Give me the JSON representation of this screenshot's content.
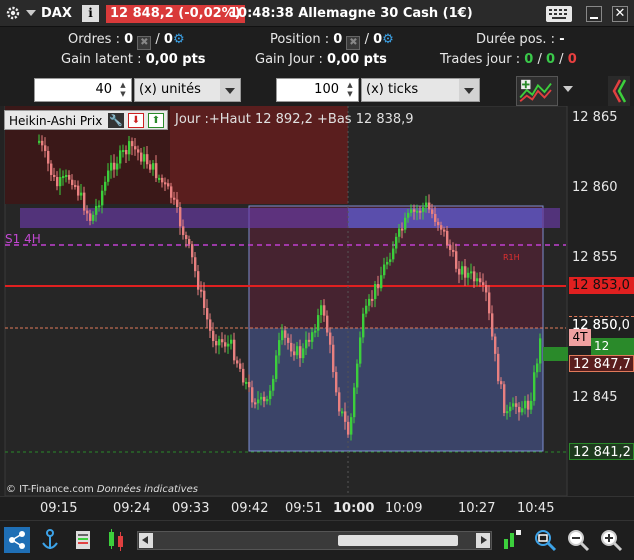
{
  "titlebar": {
    "instrument": "DAX",
    "info_icon": "i",
    "price_change": "12 848,2 (-0,02%)",
    "title": "10:48:38 Allemagne 30 Cash (1€)",
    "icons": [
      "gear-icon",
      "chevron-down-icon",
      "info-icon",
      "keyboard-icon",
      "minimize-icon",
      "close-icon"
    ],
    "close_glyph": "✕"
  },
  "info": {
    "orders_label": "Ordres : ",
    "orders_value_a": "0",
    "orders_sep": " / ",
    "orders_value_b": "0",
    "position_label": "Position : ",
    "position_value_a": "0",
    "position_sep": " / ",
    "position_value_b": "0",
    "duration_label": "Durée pos. : ",
    "duration_value": "-",
    "latent_label": "Gain latent : ",
    "latent_value": "0,00 pts",
    "gain_day_label": "Gain Jour : ",
    "gain_day_value": "0,00 pts",
    "trades_label": "Trades jour : ",
    "trades_a": "0",
    "trades_sep1": " / ",
    "trades_b": "0",
    "trades_sep2": " / ",
    "trades_c": "0"
  },
  "toolbar": {
    "units_value": "40",
    "units_select": "(x) unités",
    "ticks_value": "100",
    "ticks_select": "(x) ticks"
  },
  "chart": {
    "indicator_label": "Heikin-Ashi Prix",
    "jour_label": "Jour :+Haut 12 892,2 +Bas 12 838,9",
    "s1_label": "S1 4H",
    "r1h_label": "R1H",
    "watermark_brand": "© IT-Finance.com",
    "watermark_note": "Données indicatives",
    "y_ticks": [
      "12 865",
      "12 860",
      "12 855",
      "12 850",
      "12 845"
    ],
    "badges": {
      "line_red": "12 853,0",
      "line_salmon": "12 850,0",
      "last": "12 848,7",
      "bid": "12 847,7",
      "low": "12 841,2",
      "tag_4t": "4T"
    },
    "colors": {
      "bull": "#3ccf3c",
      "bear": "#e88080",
      "red_line": "#e02020",
      "magenta_line": "#c040d0",
      "green_dashed": "#2a8a2a",
      "salmon_line": "#e07a5a"
    }
  },
  "xaxis": {
    "labels": [
      "09:15",
      "09:24",
      "09:33",
      "09:42",
      "09:51",
      "10:00",
      "10:09",
      "10:27",
      "10:45"
    ]
  },
  "bottombar": {
    "icons": [
      "share-icon",
      "anchor-icon",
      "layers-icon",
      "candles-icon",
      "scroll-left-icon",
      "scroll-right-icon",
      "chart-tool-icon",
      "zoom-fit-icon",
      "zoom-out-icon",
      "zoom-in-icon"
    ]
  }
}
